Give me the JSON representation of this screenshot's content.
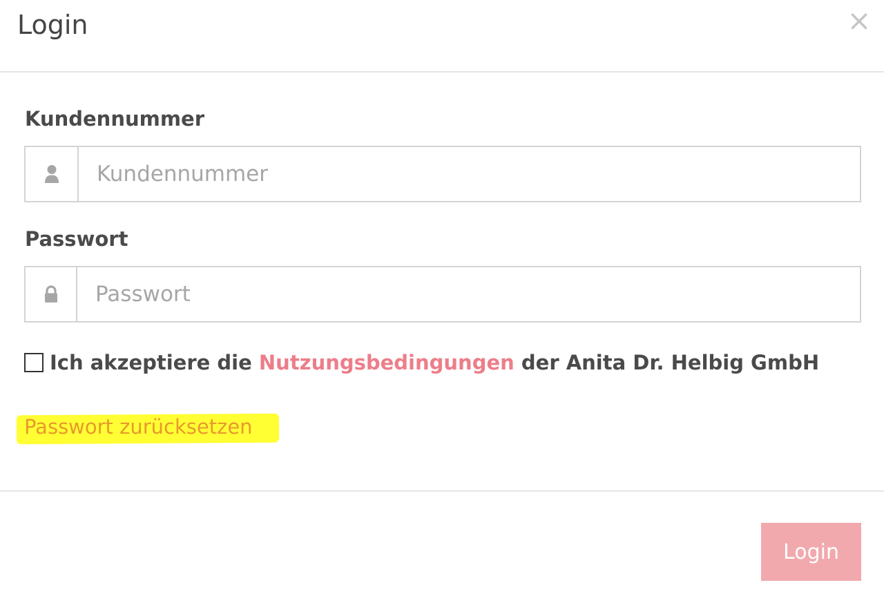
{
  "modal": {
    "title": "Login",
    "close_symbol": "×",
    "close_icon": "close-icon"
  },
  "form": {
    "customer_number": {
      "label": "Kundennummer",
      "placeholder": "Kundennummer",
      "value": "",
      "icon": "user-icon"
    },
    "password": {
      "label": "Passwort",
      "placeholder": "Passwort",
      "value": "",
      "icon": "lock-icon"
    },
    "terms": {
      "checked": false,
      "text_before": "Ich akzeptiere die",
      "link_text": "Nutzungsbedingungen",
      "text_after": "der Anita Dr. Helbig GmbH"
    },
    "reset_password_link": "Passwort zurücksetzen"
  },
  "footer": {
    "login_button": "Login"
  },
  "colors": {
    "accent": "#ec7e8a",
    "login_button_bg": "#f1a9ae",
    "highlight": "#ffff33",
    "reset_link_text": "#e79a2c"
  }
}
